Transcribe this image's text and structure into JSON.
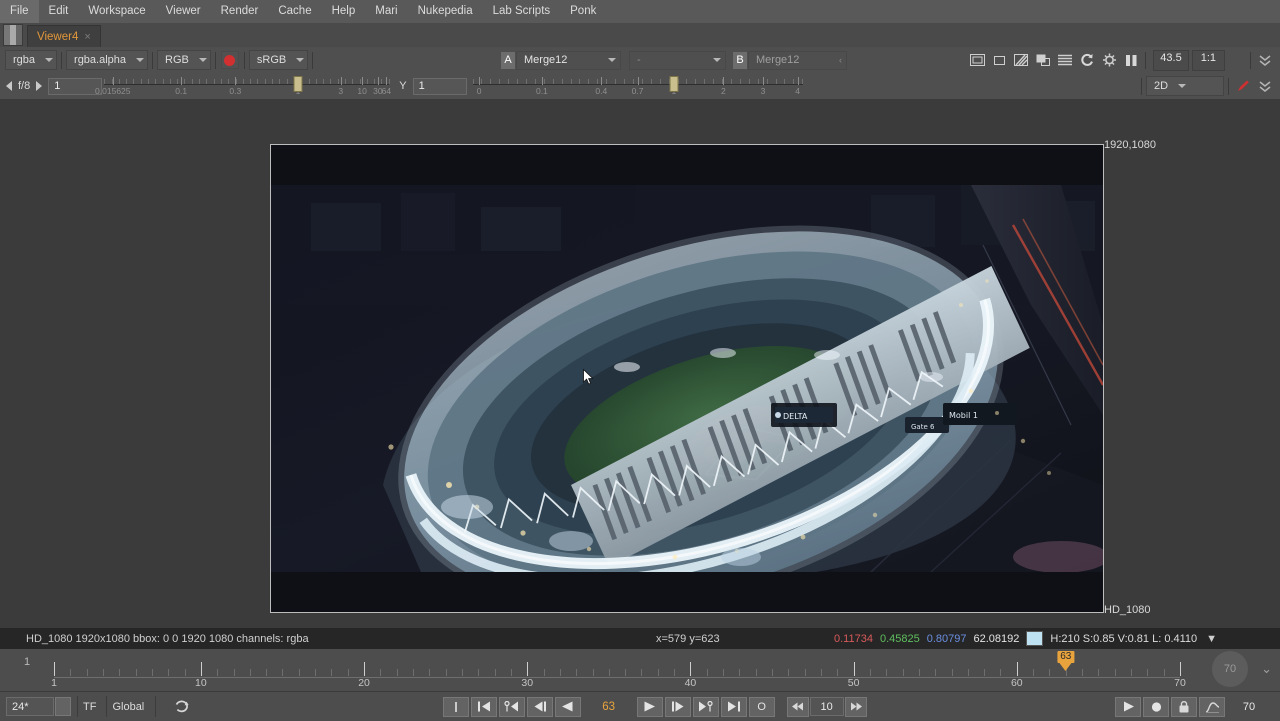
{
  "menu": {
    "items": [
      "File",
      "Edit",
      "Workspace",
      "Viewer",
      "Render",
      "Cache",
      "Help",
      "Mari",
      "Nukepedia",
      "Lab Scripts",
      "Ponk"
    ]
  },
  "tab": {
    "label": "Viewer4",
    "close": "×"
  },
  "toolbar": {
    "channels": "rgba",
    "layer": "rgba.alpha",
    "display_channel": "RGB",
    "colorspace": "sRGB",
    "mask_icon": "mask-dot-icon",
    "input_a_label": "A",
    "input_a_value": "Merge12",
    "input_op_value": "-",
    "input_b_label": "B",
    "input_b_value": "Merge12",
    "zoom_value": "43.5",
    "ratio_value": "1:1",
    "icons": [
      "roi-icon",
      "proxy-icon",
      "wipe-icon",
      "overlay-icon",
      "layers-icon",
      "refresh-icon",
      "gain-icon",
      "pause-icon"
    ]
  },
  "exposure": {
    "stop_label": "f/8",
    "value": "1",
    "ticks": [
      "0.015625",
      "0.1",
      "0.3",
      "1",
      "3",
      "10",
      "30",
      "64"
    ],
    "knob_label": "1"
  },
  "gamma": {
    "label": "Y",
    "value": "1",
    "ticks": [
      "0",
      "0.1",
      "0.4",
      "0.7",
      "1",
      "2",
      "3",
      "4"
    ]
  },
  "viewmode": {
    "value": "2D",
    "pen_icon": "pen-icon"
  },
  "viewer": {
    "format_top_right": "1920,1080",
    "format_bottom_right": "HD_1080",
    "cursor_icon": "mouse-pointer-icon"
  },
  "status": {
    "format": "HD_1080 1920x1080  bbox: 0 0 1920 1080 channels: rgba",
    "coords": "x=579 y=623",
    "r": "0.11734",
    "g": "0.45825",
    "b": "0.80797",
    "a": "62.08192",
    "hsvl": "H:210 S:0.85 V:0.81  L: 0.4110",
    "swatch_color": "#bfe2f2"
  },
  "timeline": {
    "current_frame_label": "1",
    "start": 1,
    "end": 70,
    "major_ticks": [
      1,
      10,
      20,
      30,
      40,
      50,
      60,
      70
    ],
    "playhead_frame": 63,
    "playhead_label": "63",
    "play_badge": "70"
  },
  "transport": {
    "fps": "24*",
    "timecode_mode": "TF",
    "scope": "Global",
    "loop_icon": "loop-icon",
    "buttons": [
      "in-point-icon",
      "first-frame-icon",
      "prev-key-icon",
      "prev-frame-icon",
      "play-back-icon"
    ],
    "frame": "63",
    "buttons_right": [
      "play-forward-icon",
      "next-frame-icon",
      "next-key-icon",
      "last-frame-icon",
      "out-point-icon"
    ],
    "out_label": "O",
    "step_back_icon": "step-back-icon",
    "increment": "10",
    "step_fwd_icon": "step-forward-icon",
    "right_icons": [
      "play-range-icon",
      "record-icon",
      "lock-icon",
      "curve-icon"
    ],
    "end_frame": "70"
  },
  "colors": {
    "accent": "#e8a33d",
    "bg": "#3d3d3d",
    "panel": "#4f4f4f",
    "status_bg": "#262626"
  }
}
